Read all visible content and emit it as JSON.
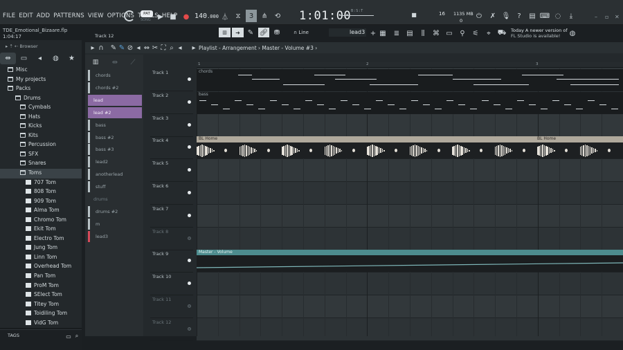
{
  "menu": [
    "FILE",
    "EDIT",
    "ADD",
    "PATTERNS",
    "VIEW",
    "OPTIONS",
    "TOOLS",
    "HELP"
  ],
  "project": {
    "file_name": "TDE_Emotional_Bizaare.flp",
    "time": "1:04:17"
  },
  "transport": {
    "pat_label": "PAT",
    "song_label": "SONG",
    "tempo": "140",
    "tempo_dec": ".000",
    "time": "1:01",
    "time_sub": ":00",
    "time_unit": "B:S:T"
  },
  "stats": {
    "cpu": "16",
    "memory": "1135 MB",
    "polyphony": "0"
  },
  "toolbar2": {
    "channel": "Track 12",
    "snap": "Line",
    "pattern": "lead3"
  },
  "hint": {
    "line1": "Today  A newer version of",
    "line2": "FL Studio is available!"
  },
  "browser": {
    "title": "Browser",
    "tags_label": "TAGS",
    "tree": [
      {
        "label": "Misc",
        "type": "folder",
        "indent": 1
      },
      {
        "label": "My projects",
        "type": "folder",
        "indent": 1
      },
      {
        "label": "Packs",
        "type": "folder",
        "indent": 1
      },
      {
        "label": "Drums",
        "type": "folder",
        "indent": 2
      },
      {
        "label": "Cymbals",
        "type": "folder",
        "indent": 3
      },
      {
        "label": "Hats",
        "type": "folder",
        "indent": 3
      },
      {
        "label": "Kicks",
        "type": "folder",
        "indent": 3
      },
      {
        "label": "Kits",
        "type": "folder",
        "indent": 3
      },
      {
        "label": "Percussion",
        "type": "folder",
        "indent": 3
      },
      {
        "label": "SFX",
        "type": "folder",
        "indent": 3
      },
      {
        "label": "Snares",
        "type": "folder",
        "indent": 3
      },
      {
        "label": "Toms",
        "type": "folder",
        "indent": 3,
        "selected": true
      },
      {
        "label": "707 Tom",
        "type": "file",
        "indent": 4
      },
      {
        "label": "808 Tom",
        "type": "file",
        "indent": 4
      },
      {
        "label": "909 Tom",
        "type": "file",
        "indent": 4
      },
      {
        "label": "Alma Tom",
        "type": "file",
        "indent": 4
      },
      {
        "label": "Chromo Tom",
        "type": "file",
        "indent": 4
      },
      {
        "label": "Ekit Tom",
        "type": "file",
        "indent": 4
      },
      {
        "label": "Electro Tom",
        "type": "file",
        "indent": 4
      },
      {
        "label": "Jung Tom",
        "type": "file",
        "indent": 4
      },
      {
        "label": "Linn Tom",
        "type": "file",
        "indent": 4
      },
      {
        "label": "Overhead Tom",
        "type": "file",
        "indent": 4
      },
      {
        "label": "Pan Tom",
        "type": "file",
        "indent": 4
      },
      {
        "label": "ProM Tom",
        "type": "file",
        "indent": 4
      },
      {
        "label": "SElect Tom",
        "type": "file",
        "indent": 4
      },
      {
        "label": "Titey Tom",
        "type": "file",
        "indent": 4
      },
      {
        "label": "Toidiling Tom",
        "type": "file",
        "indent": 4
      },
      {
        "label": "VidG Tom",
        "type": "file",
        "indent": 4
      },
      {
        "label": "Drums (ModeAudio)",
        "type": "folder",
        "indent": 2,
        "dark": true
      }
    ]
  },
  "playlist": {
    "title": "Playlist - Arrangement",
    "breadcrumb_1": "Master",
    "breadcrumb_2": "Volume #3",
    "bar_numbers": [
      "1",
      "2",
      "3"
    ],
    "clips": [
      {
        "label": "chords",
        "style": "stripe"
      },
      {
        "label": "chords #2",
        "style": "stripe"
      },
      {
        "label": "lead",
        "style": "purple"
      },
      {
        "label": "lead #2",
        "style": "purple"
      },
      {
        "label": "bass",
        "style": "stripe"
      },
      {
        "label": "bass #2",
        "style": "stripe"
      },
      {
        "label": "bass #3",
        "style": "stripe"
      },
      {
        "label": "lead2",
        "style": "stripe"
      },
      {
        "label": "anotherlead",
        "style": "stripe"
      },
      {
        "label": "stuff",
        "style": "stripe"
      },
      {
        "label": "drums",
        "style": "faint"
      },
      {
        "label": "drums #2",
        "style": "stripe"
      },
      {
        "label": "m",
        "style": "stripe"
      },
      {
        "label": "lead3",
        "style": "red"
      }
    ],
    "tracks": [
      {
        "name": "Track 1",
        "active": true
      },
      {
        "name": "Track 2",
        "active": true
      },
      {
        "name": "Track 3",
        "active": true
      },
      {
        "name": "Track 4",
        "active": true
      },
      {
        "name": "Track 5",
        "active": true
      },
      {
        "name": "Track 6",
        "active": true
      },
      {
        "name": "Track 7",
        "active": true
      },
      {
        "name": "Track 8",
        "active": false
      },
      {
        "name": "Track 9",
        "active": true
      },
      {
        "name": "Track 10",
        "active": true
      },
      {
        "name": "Track 11",
        "active": false
      },
      {
        "name": "Track 12",
        "active": false
      }
    ],
    "lane_clips": {
      "chords": "chords",
      "bass": "bass",
      "audio": "BL Home",
      "automation": "Master - Volume"
    }
  }
}
